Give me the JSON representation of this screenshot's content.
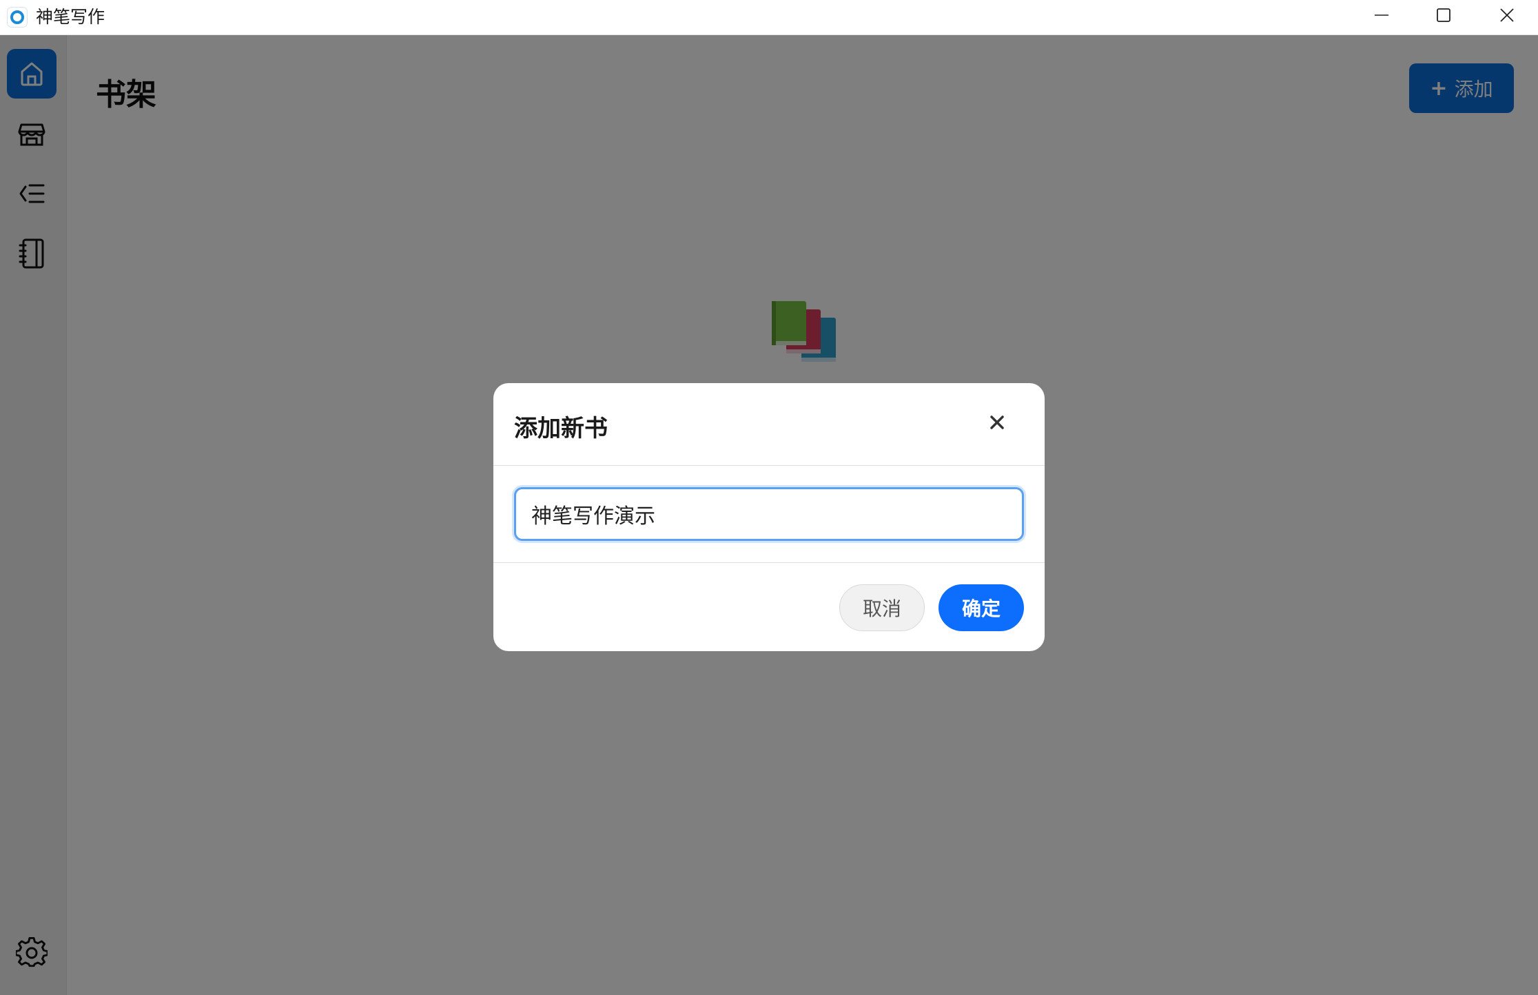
{
  "window": {
    "title": "神笔写作",
    "icon": "app-ring-icon",
    "controls": [
      "minimize-icon",
      "maximize-icon",
      "close-icon"
    ]
  },
  "sidebar": {
    "items": [
      {
        "name": "home",
        "icon": "home-icon",
        "active": true
      },
      {
        "name": "store",
        "icon": "store-icon",
        "active": false
      },
      {
        "name": "outline",
        "icon": "list-indent-icon",
        "active": false
      },
      {
        "name": "notebook",
        "icon": "notebook-icon",
        "active": false
      }
    ],
    "bottom": {
      "name": "settings",
      "icon": "gear-icon"
    }
  },
  "main": {
    "title": "书架",
    "add_label": "添加",
    "add_icon": "plus-icon",
    "empty_icon": "books-icon"
  },
  "modal": {
    "title": "添加新书",
    "input_value": "神笔写作演示",
    "cancel_label": "取消",
    "confirm_label": "确定"
  },
  "colors": {
    "accent": "#0a6fd8",
    "confirm": "#0d6efd",
    "overlay": "rgba(0,0,0,0.5)"
  }
}
